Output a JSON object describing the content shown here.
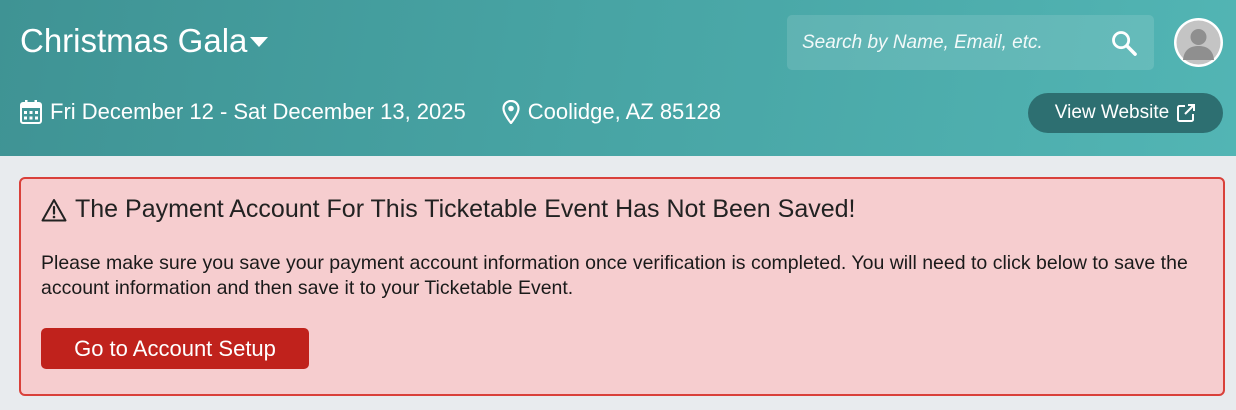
{
  "header": {
    "event_title": "Christmas Gala",
    "search": {
      "placeholder": "Search by Name, Email, etc.",
      "value": ""
    },
    "dates": "Fri December 12 - Sat December 13, 2025",
    "location": "Coolidge, AZ 85128",
    "view_website_label": "View Website",
    "icons": {
      "title_dropdown": "caret-down-icon",
      "search": "search-icon",
      "avatar": "user-avatar-icon",
      "dates": "calendar-icon",
      "location": "map-pin-icon",
      "view_website": "external-link-icon"
    }
  },
  "alert": {
    "icon": "warning-triangle-icon",
    "title": "The Payment Account For This Ticketable Event Has Not Been Saved!",
    "body": "Please make sure you save your payment account information once verification is completed. You will need to click below to save the account information and then save it to your Ticketable Event.",
    "button_label": "Go to Account Setup"
  },
  "colors": {
    "header_gradient_start": "#3f9394",
    "header_gradient_end": "#52b5b4",
    "view_website_bg": "#2d6f71",
    "page_bg": "#e8ebee",
    "alert_bg": "#f6cdcf",
    "alert_border": "#d9403a",
    "alert_button_bg": "#c0221c"
  }
}
